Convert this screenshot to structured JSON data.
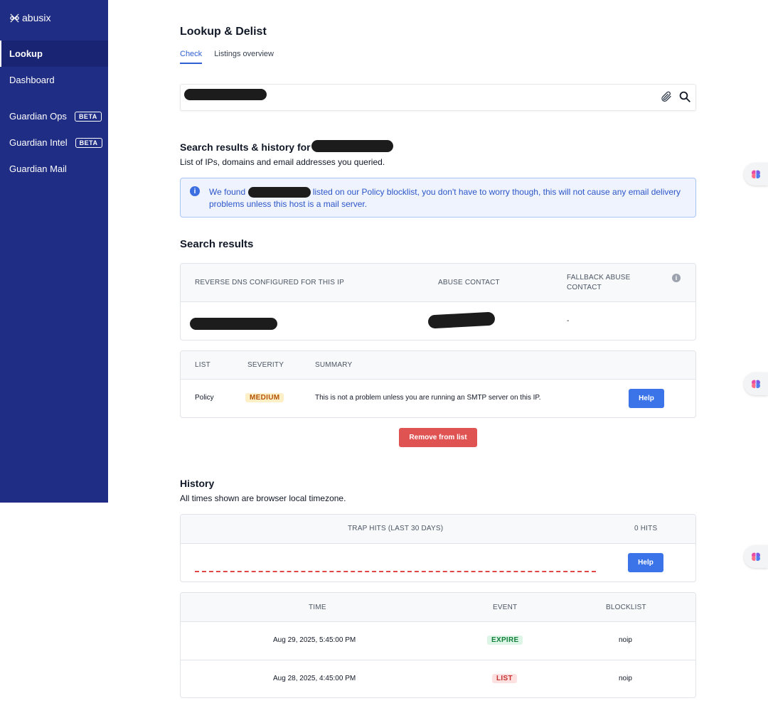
{
  "app": {
    "logo_text": "abusix"
  },
  "sidebar": {
    "items": [
      {
        "label": "Lookup",
        "active": true
      },
      {
        "label": "Dashboard"
      },
      {
        "label": "Guardian Ops",
        "badge": "BETA"
      },
      {
        "label": "Guardian Intel",
        "badge": "BETA"
      },
      {
        "label": "Guardian Mail"
      }
    ]
  },
  "page": {
    "title": "Lookup & Delist",
    "tabs": [
      {
        "label": "Check",
        "active": true
      },
      {
        "label": "Listings overview"
      }
    ]
  },
  "search": {
    "value": "[redacted]",
    "attach_icon": "paperclip-icon",
    "search_icon": "search-icon"
  },
  "results_header": {
    "title": "Search results & history for",
    "subtitle": "List of IPs, domains and email addresses you queried."
  },
  "info": {
    "icon": "info-icon",
    "prefix": "We found",
    "message": "listed on our Policy blocklist, you don't have to worry though, this will not cause any email delivery problems unless this host is a mail server."
  },
  "search_results": {
    "title": "Search results",
    "columns": [
      "REVERSE DNS CONFIGURED FOR THIS IP",
      "ABUSE CONTACT",
      "FALLBACK ABUSE CONTACT"
    ],
    "row": {
      "fallback": "-"
    }
  },
  "listings": {
    "columns": [
      "LIST",
      "SEVERITY",
      "SUMMARY"
    ],
    "rows": [
      {
        "list": "Policy",
        "severity": "MEDIUM",
        "summary": "This is not a problem unless you are running an SMTP server on this IP.",
        "action": "Help"
      }
    ],
    "remove_label": "Remove from list"
  },
  "history": {
    "title": "History",
    "subtitle": "All times shown are browser local timezone.",
    "trap": {
      "label": "TRAP HITS (LAST 30 DAYS)",
      "hits": "0 HITS",
      "action": "Help"
    },
    "columns": [
      "TIME",
      "EVENT",
      "BLOCKLIST"
    ],
    "rows": [
      {
        "time": "Aug 29, 2025, 5:45:00 PM",
        "event": "EXPIRE",
        "blocklist": "noip"
      },
      {
        "time": "Aug 28, 2025, 4:45:00 PM",
        "event": "LIST",
        "blocklist": "noip"
      }
    ]
  },
  "colors": {
    "sidebar": "#1f2d84",
    "accent": "#3b74e8",
    "danger": "#e05353",
    "medium_badge": "#fdf0c6",
    "expire_badge": "#dcf5e6",
    "list_badge": "#fde1e1"
  }
}
